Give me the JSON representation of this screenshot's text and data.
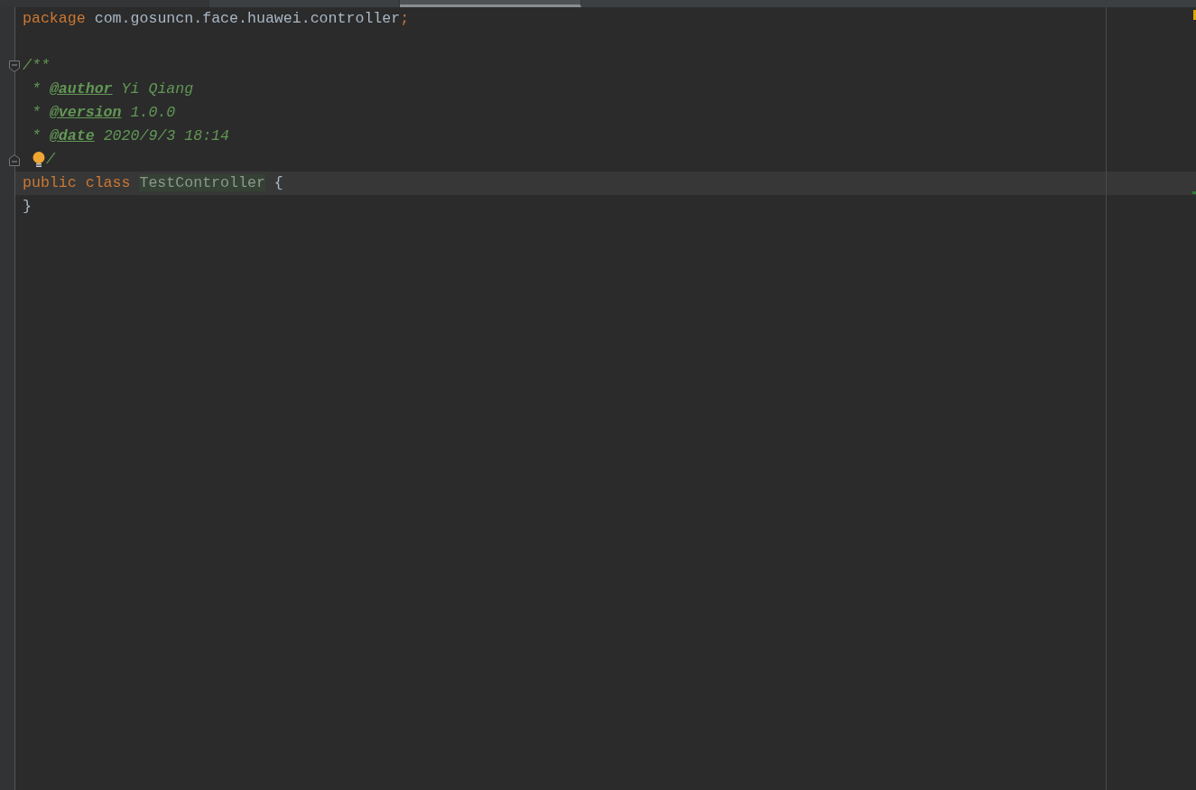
{
  "tabs": [
    {
      "selected": false
    },
    {
      "selected": false
    },
    {
      "selected": true
    }
  ],
  "lines": [
    {
      "current": false,
      "fold_start": false,
      "fold_end": false,
      "tokens": [
        {
          "kind": "keyword",
          "text": "package"
        },
        {
          "kind": "plain",
          "text": " com.gosuncn.face.huawei.controller"
        },
        {
          "kind": "keyword",
          "text": ";"
        }
      ]
    },
    {
      "current": false,
      "fold_start": false,
      "fold_end": false
    },
    {
      "current": false,
      "fold_start": true,
      "fold_end": false,
      "tokens": [
        {
          "kind": "doc",
          "text": "/**"
        }
      ]
    },
    {
      "current": false,
      "fold_start": false,
      "fold_end": false,
      "tokens": [
        {
          "kind": "doc",
          "text": " * "
        },
        {
          "kind": "doctag",
          "text": "@author"
        },
        {
          "kind": "doc",
          "text": " Yi Qiang"
        }
      ]
    },
    {
      "current": false,
      "fold_start": false,
      "fold_end": false,
      "tokens": [
        {
          "kind": "doc",
          "text": " * "
        },
        {
          "kind": "doctag",
          "text": "@version"
        },
        {
          "kind": "doc",
          "text": " 1.0.0"
        }
      ]
    },
    {
      "current": false,
      "fold_start": false,
      "fold_end": false,
      "tokens": [
        {
          "kind": "doc",
          "text": " * "
        },
        {
          "kind": "doctag",
          "text": "@date"
        },
        {
          "kind": "doc",
          "text": " 2020/9/3 18:14"
        }
      ]
    },
    {
      "current": false,
      "fold_start": false,
      "fold_end": true,
      "tokens": [
        {
          "kind": "bulb"
        },
        {
          "kind": "doc",
          "text": "/"
        }
      ]
    },
    {
      "current": true,
      "fold_start": false,
      "fold_end": false,
      "tokens": [
        {
          "kind": "keyword",
          "text": "public class "
        },
        {
          "kind": "classname",
          "text": "TestController"
        },
        {
          "kind": "plain",
          "text": " {"
        }
      ]
    },
    {
      "current": false,
      "fold_start": false,
      "fold_end": false,
      "tokens": [
        {
          "kind": "plain",
          "text": "}"
        }
      ]
    }
  ]
}
